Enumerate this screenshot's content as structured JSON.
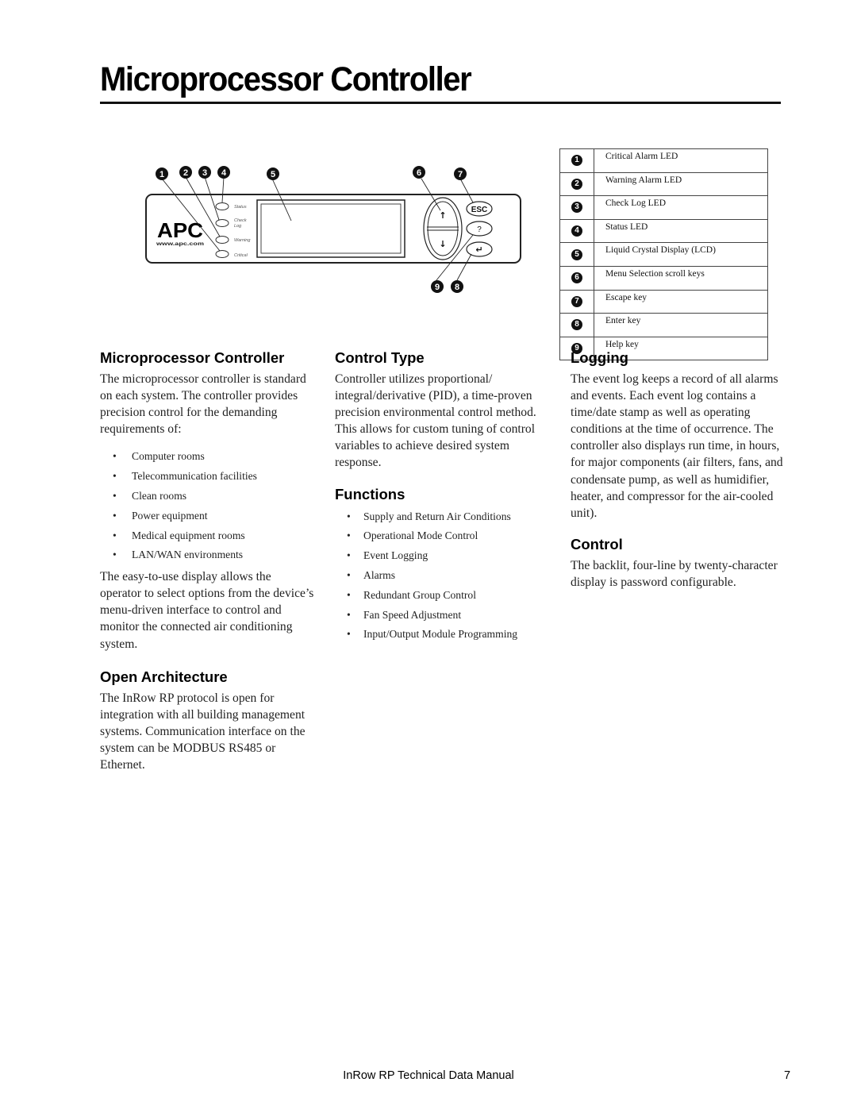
{
  "page": {
    "title": "Microprocessor Controller",
    "footer_title": "InRow RP Technical Data Manual",
    "page_number": "7"
  },
  "diagram": {
    "logo": "APC",
    "logo_url_text": "www.apc.com",
    "led_labels": [
      "Status",
      "Check",
      "Log",
      "Warning",
      "Critical"
    ],
    "keys": {
      "up": "↑",
      "down": "↓",
      "escape": "ESC",
      "help": "?",
      "enter": "↵"
    },
    "callouts": [
      "1",
      "2",
      "3",
      "4",
      "5",
      "6",
      "7",
      "8",
      "9"
    ]
  },
  "legend": [
    {
      "num": "1",
      "label": "Critical Alarm LED"
    },
    {
      "num": "2",
      "label": "Warning Alarm LED"
    },
    {
      "num": "3",
      "label": "Check Log LED"
    },
    {
      "num": "4",
      "label": "Status LED"
    },
    {
      "num": "5",
      "label": "Liquid Crystal Display (LCD)"
    },
    {
      "num": "6",
      "label": "Menu Selection scroll keys"
    },
    {
      "num": "7",
      "label": "Escape key"
    },
    {
      "num": "8",
      "label": "Enter key"
    },
    {
      "num": "9",
      "label": "Help key"
    }
  ],
  "sections": {
    "microprocessor": {
      "heading": "Microprocessor Controller",
      "intro": "The microprocessor controller is standard on each system. The controller provides precision control for the demanding requirements of:",
      "items": [
        "Computer rooms",
        "Telecommunication facilities",
        "Clean rooms",
        "Power equipment",
        "Medical equipment rooms",
        "LAN/WAN environments"
      ],
      "outro": "The easy-to-use display allows the operator to select options from the device’s menu-driven interface to control and monitor the connected air conditioning system."
    },
    "open_architecture": {
      "heading": "Open Architecture",
      "body": "The InRow RP protocol is open for integration with all building management systems. Communication interface on the system can be MODBUS RS485 or Ethernet."
    },
    "control_type": {
      "heading": "Control Type",
      "body": "Controller utilizes proportional/ integral/derivative (PID), a time-proven precision environmental control method. This allows for custom tuning of control variables to achieve desired system response."
    },
    "functions": {
      "heading": "Functions",
      "items": [
        "Supply and Return Air Conditions",
        "Operational Mode Control",
        "Event Logging",
        "Alarms",
        "Redundant Group Control",
        "Fan Speed Adjustment",
        "Input/Output Module Programming"
      ]
    },
    "logging": {
      "heading": "Logging",
      "body": "The event log keeps a record of all alarms and events. Each event log contains a time/date stamp as well as operating conditions at the time of occurrence. The controller also displays run time, in hours, for major components (air filters, fans, and condensate pump, as well as humidifier, heater, and compressor for the air-cooled unit)."
    },
    "control": {
      "heading": "Control",
      "body": "The backlit, four-line by twenty-character display is password configurable."
    }
  }
}
